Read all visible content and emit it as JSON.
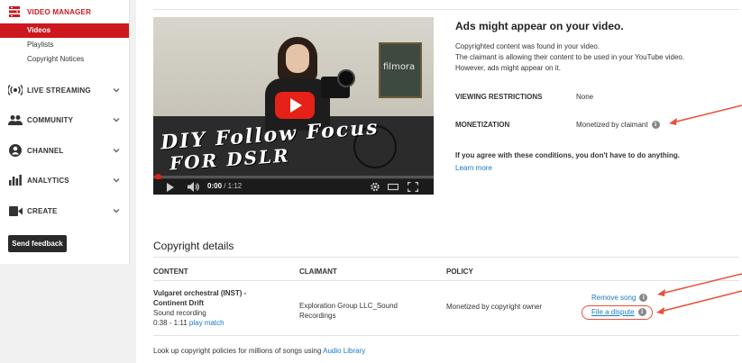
{
  "sidebar": {
    "header": "VIDEO MANAGER",
    "sub_items": [
      {
        "label": "Videos",
        "active": true
      },
      {
        "label": "Playlists",
        "active": false
      },
      {
        "label": "Copyright Notices",
        "active": false
      }
    ],
    "sections": [
      {
        "label": "LIVE STREAMING",
        "icon": "live-streaming-icon"
      },
      {
        "label": "COMMUNITY",
        "icon": "community-icon"
      },
      {
        "label": "CHANNEL",
        "icon": "channel-icon"
      },
      {
        "label": "ANALYTICS",
        "icon": "analytics-icon"
      },
      {
        "label": "CREATE",
        "icon": "create-icon"
      }
    ],
    "feedback_label": "Send feedback",
    "accent_color": "#cc181e"
  },
  "video": {
    "overlay_line1": "DIY Follow Focus",
    "overlay_line2": "FOR DSLR",
    "board_text": "filmora",
    "time_current": "0:00",
    "time_total": " / 1:12"
  },
  "ads": {
    "title": "Ads might appear on your video.",
    "description": [
      "Copyrighted content was found in your video.",
      "The claimant is allowing their content to be used in your YouTube video.",
      "However, ads might appear on it."
    ],
    "viewing_restrictions_label": "VIEWING RESTRICTIONS",
    "viewing_restrictions_value": "None",
    "monetization_label": "MONETIZATION",
    "monetization_value": "Monetized by claimant",
    "agree_text": "If you agree with these conditions, you don't have to do anything.",
    "learn_more": "Learn more"
  },
  "copyright": {
    "title": "Copyright details",
    "columns": [
      "CONTENT",
      "CLAIMANT",
      "POLICY"
    ],
    "row": {
      "content_title_1": "Vulgaret orchestral (INST) -",
      "content_title_2": "Continent Drift",
      "content_type": "Sound recording",
      "content_range": "0:38 - 1:11",
      "play_match": "play match",
      "claimant_1": "Exploration Group LLC_Sound",
      "claimant_2": "Recordings",
      "policy": "Monetized by copyright owner",
      "remove_song": "Remove song",
      "file_dispute": "File a dispute"
    },
    "lookup_text": "Look up copyright policies for millions of songs using",
    "audio_library": "Audio Library"
  },
  "colors": {
    "link": "#167ac6",
    "annotation": "#e8503a",
    "play_button": "#e62117"
  }
}
